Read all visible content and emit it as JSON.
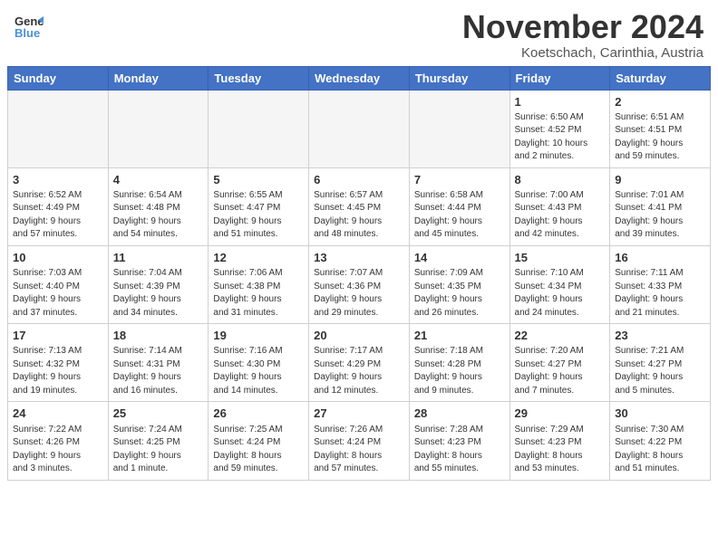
{
  "header": {
    "logo_general": "General",
    "logo_blue": "Blue",
    "month_title": "November 2024",
    "location": "Koetschach, Carinthia, Austria"
  },
  "weekdays": [
    "Sunday",
    "Monday",
    "Tuesday",
    "Wednesday",
    "Thursday",
    "Friday",
    "Saturday"
  ],
  "weeks": [
    [
      {
        "day": "",
        "info": ""
      },
      {
        "day": "",
        "info": ""
      },
      {
        "day": "",
        "info": ""
      },
      {
        "day": "",
        "info": ""
      },
      {
        "day": "",
        "info": ""
      },
      {
        "day": "1",
        "info": "Sunrise: 6:50 AM\nSunset: 4:52 PM\nDaylight: 10 hours\nand 2 minutes."
      },
      {
        "day": "2",
        "info": "Sunrise: 6:51 AM\nSunset: 4:51 PM\nDaylight: 9 hours\nand 59 minutes."
      }
    ],
    [
      {
        "day": "3",
        "info": "Sunrise: 6:52 AM\nSunset: 4:49 PM\nDaylight: 9 hours\nand 57 minutes."
      },
      {
        "day": "4",
        "info": "Sunrise: 6:54 AM\nSunset: 4:48 PM\nDaylight: 9 hours\nand 54 minutes."
      },
      {
        "day": "5",
        "info": "Sunrise: 6:55 AM\nSunset: 4:47 PM\nDaylight: 9 hours\nand 51 minutes."
      },
      {
        "day": "6",
        "info": "Sunrise: 6:57 AM\nSunset: 4:45 PM\nDaylight: 9 hours\nand 48 minutes."
      },
      {
        "day": "7",
        "info": "Sunrise: 6:58 AM\nSunset: 4:44 PM\nDaylight: 9 hours\nand 45 minutes."
      },
      {
        "day": "8",
        "info": "Sunrise: 7:00 AM\nSunset: 4:43 PM\nDaylight: 9 hours\nand 42 minutes."
      },
      {
        "day": "9",
        "info": "Sunrise: 7:01 AM\nSunset: 4:41 PM\nDaylight: 9 hours\nand 39 minutes."
      }
    ],
    [
      {
        "day": "10",
        "info": "Sunrise: 7:03 AM\nSunset: 4:40 PM\nDaylight: 9 hours\nand 37 minutes."
      },
      {
        "day": "11",
        "info": "Sunrise: 7:04 AM\nSunset: 4:39 PM\nDaylight: 9 hours\nand 34 minutes."
      },
      {
        "day": "12",
        "info": "Sunrise: 7:06 AM\nSunset: 4:38 PM\nDaylight: 9 hours\nand 31 minutes."
      },
      {
        "day": "13",
        "info": "Sunrise: 7:07 AM\nSunset: 4:36 PM\nDaylight: 9 hours\nand 29 minutes."
      },
      {
        "day": "14",
        "info": "Sunrise: 7:09 AM\nSunset: 4:35 PM\nDaylight: 9 hours\nand 26 minutes."
      },
      {
        "day": "15",
        "info": "Sunrise: 7:10 AM\nSunset: 4:34 PM\nDaylight: 9 hours\nand 24 minutes."
      },
      {
        "day": "16",
        "info": "Sunrise: 7:11 AM\nSunset: 4:33 PM\nDaylight: 9 hours\nand 21 minutes."
      }
    ],
    [
      {
        "day": "17",
        "info": "Sunrise: 7:13 AM\nSunset: 4:32 PM\nDaylight: 9 hours\nand 19 minutes."
      },
      {
        "day": "18",
        "info": "Sunrise: 7:14 AM\nSunset: 4:31 PM\nDaylight: 9 hours\nand 16 minutes."
      },
      {
        "day": "19",
        "info": "Sunrise: 7:16 AM\nSunset: 4:30 PM\nDaylight: 9 hours\nand 14 minutes."
      },
      {
        "day": "20",
        "info": "Sunrise: 7:17 AM\nSunset: 4:29 PM\nDaylight: 9 hours\nand 12 minutes."
      },
      {
        "day": "21",
        "info": "Sunrise: 7:18 AM\nSunset: 4:28 PM\nDaylight: 9 hours\nand 9 minutes."
      },
      {
        "day": "22",
        "info": "Sunrise: 7:20 AM\nSunset: 4:27 PM\nDaylight: 9 hours\nand 7 minutes."
      },
      {
        "day": "23",
        "info": "Sunrise: 7:21 AM\nSunset: 4:27 PM\nDaylight: 9 hours\nand 5 minutes."
      }
    ],
    [
      {
        "day": "24",
        "info": "Sunrise: 7:22 AM\nSunset: 4:26 PM\nDaylight: 9 hours\nand 3 minutes."
      },
      {
        "day": "25",
        "info": "Sunrise: 7:24 AM\nSunset: 4:25 PM\nDaylight: 9 hours\nand 1 minute."
      },
      {
        "day": "26",
        "info": "Sunrise: 7:25 AM\nSunset: 4:24 PM\nDaylight: 8 hours\nand 59 minutes."
      },
      {
        "day": "27",
        "info": "Sunrise: 7:26 AM\nSunset: 4:24 PM\nDaylight: 8 hours\nand 57 minutes."
      },
      {
        "day": "28",
        "info": "Sunrise: 7:28 AM\nSunset: 4:23 PM\nDaylight: 8 hours\nand 55 minutes."
      },
      {
        "day": "29",
        "info": "Sunrise: 7:29 AM\nSunset: 4:23 PM\nDaylight: 8 hours\nand 53 minutes."
      },
      {
        "day": "30",
        "info": "Sunrise: 7:30 AM\nSunset: 4:22 PM\nDaylight: 8 hours\nand 51 minutes."
      }
    ]
  ]
}
